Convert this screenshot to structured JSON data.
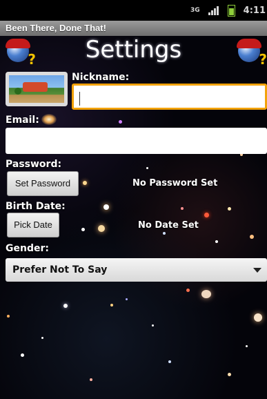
{
  "statusbar": {
    "network": "3G",
    "time": "4:11"
  },
  "app": {
    "title": "Been There, Done That!"
  },
  "header": {
    "title": "Settings"
  },
  "fields": {
    "nickname": {
      "label": "Nickname:",
      "value": ""
    },
    "email": {
      "label": "Email:",
      "value": ""
    },
    "password": {
      "label": "Password:",
      "button": "Set Password",
      "status": "No Password Set"
    },
    "birth_date": {
      "label": "Birth Date:",
      "button": "Pick Date",
      "status": "No Date Set"
    },
    "gender": {
      "label": "Gender:",
      "selected": "Prefer Not To Say"
    }
  },
  "colors": {
    "focus_border": "#f2a20a",
    "title_bar": "#8a8a8a",
    "background": "#04040a"
  },
  "icons": [
    "globe-question-icon",
    "avatar-image",
    "galaxy-icon",
    "dropdown-arrow-icon",
    "signal-icon",
    "battery-icon"
  ]
}
